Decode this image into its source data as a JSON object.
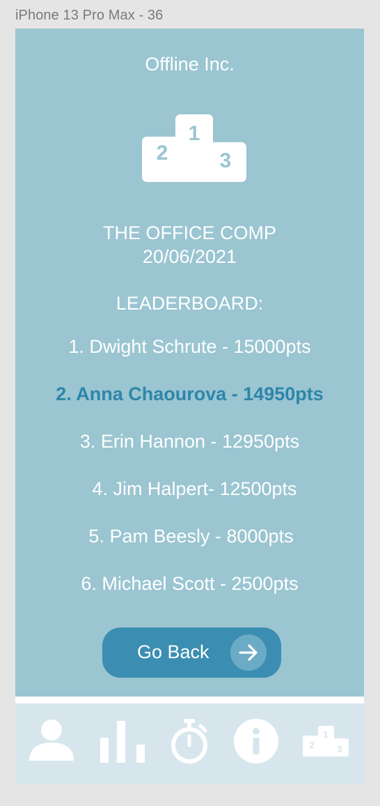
{
  "frame": {
    "label": "iPhone 13 Pro Max - 36"
  },
  "header": {
    "company": "Offline Inc."
  },
  "competition": {
    "name": "THE OFFICE COMP",
    "date": "20/06/2021"
  },
  "leaderboard": {
    "title": "LEADERBOARD:",
    "entries": [
      {
        "text": "1. Dwight Schrute - 15000pts",
        "highlight": false
      },
      {
        "text": "2. Anna Chaourova - 14950pts",
        "highlight": true
      },
      {
        "text": "3. Erin Hannon - 12950pts",
        "highlight": false
      },
      {
        "text": "4. Jim Halpert- 12500pts",
        "highlight": false
      },
      {
        "text": "5. Pam Beesly - 8000pts",
        "highlight": false
      },
      {
        "text": "6. Michael Scott - 2500pts",
        "highlight": false
      }
    ]
  },
  "actions": {
    "go_back_label": "Go Back"
  },
  "tabbar": {
    "items": [
      {
        "icon": "person-icon"
      },
      {
        "icon": "bar-chart-icon"
      },
      {
        "icon": "stopwatch-icon"
      },
      {
        "icon": "info-icon"
      },
      {
        "icon": "podium-icon"
      }
    ]
  },
  "podium": {
    "first": "1",
    "second": "2",
    "third": "3"
  },
  "colors": {
    "background": "#9ac5d1",
    "highlight_text": "#2e86a9",
    "button": "#3b8eb1",
    "tabbar": "#d7e6ec"
  }
}
